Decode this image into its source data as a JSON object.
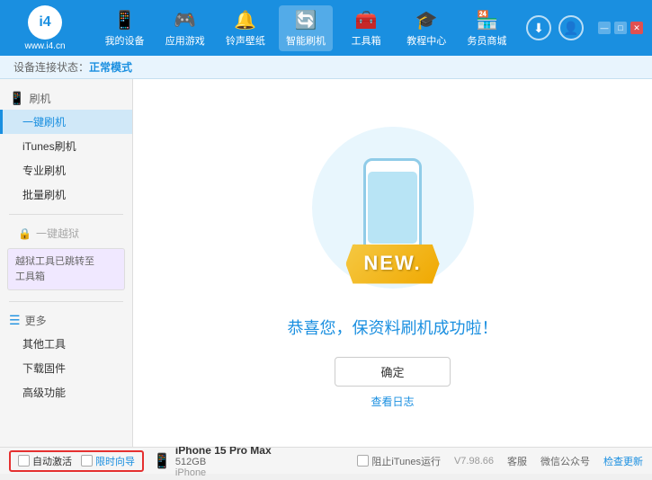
{
  "app": {
    "logo_text": "www.i4.cn",
    "logo_char": "i4"
  },
  "header": {
    "nav_items": [
      {
        "id": "my-device",
        "label": "我的设备",
        "icon": "📱"
      },
      {
        "id": "apps-games",
        "label": "应用游戏",
        "icon": "👤"
      },
      {
        "id": "ringtones",
        "label": "铃声壁纸",
        "icon": "🔔"
      },
      {
        "id": "smart-flash",
        "label": "智能刷机",
        "icon": "🔄",
        "active": true
      },
      {
        "id": "toolbox",
        "label": "工具箱",
        "icon": "🧰"
      },
      {
        "id": "tutorials",
        "label": "教程中心",
        "icon": "🎓"
      },
      {
        "id": "service",
        "label": "务员商城",
        "icon": "🏪"
      }
    ],
    "download_icon": "⬇",
    "user_icon": "👤"
  },
  "status_bar": {
    "label": "设备连接状态：",
    "mode": "正常模式"
  },
  "sidebar": {
    "sections": [
      {
        "id": "flash",
        "header": "刷机",
        "icon": "📱",
        "items": [
          {
            "id": "one-key-flash",
            "label": "一键刷机",
            "active": true
          },
          {
            "id": "itunes-flash",
            "label": "iTunes刷机"
          },
          {
            "id": "pro-flash",
            "label": "专业刷机"
          },
          {
            "id": "batch-flash",
            "label": "批量刷机"
          }
        ]
      },
      {
        "id": "one-click-jb",
        "header": "一键越狱",
        "icon": "🔒",
        "disabled": true,
        "notice": "越狱工具已跳转至\n工具箱"
      },
      {
        "id": "more",
        "header": "更多",
        "icon": "☰",
        "items": [
          {
            "id": "other-tools",
            "label": "其他工具"
          },
          {
            "id": "download-fw",
            "label": "下载固件"
          },
          {
            "id": "advanced",
            "label": "高级功能"
          }
        ]
      }
    ]
  },
  "content": {
    "new_badge": "NEW.",
    "success_message": "恭喜您，保资料刷机成功啦！",
    "confirm_button": "确定",
    "log_link": "查看日志"
  },
  "bottom": {
    "auto_activate_label": "自动激活",
    "timed_guide_label": "限时向导",
    "device": {
      "name": "iPhone 15 Pro Max",
      "storage": "512GB",
      "type": "iPhone",
      "icon": "📱"
    },
    "stop_itunes_label": "阻止iTunes运行",
    "version": "V7.98.66",
    "links": [
      {
        "id": "customer-service",
        "label": "客服"
      },
      {
        "id": "wechat",
        "label": "微信公众号"
      },
      {
        "id": "check-update",
        "label": "检查更新"
      }
    ]
  }
}
